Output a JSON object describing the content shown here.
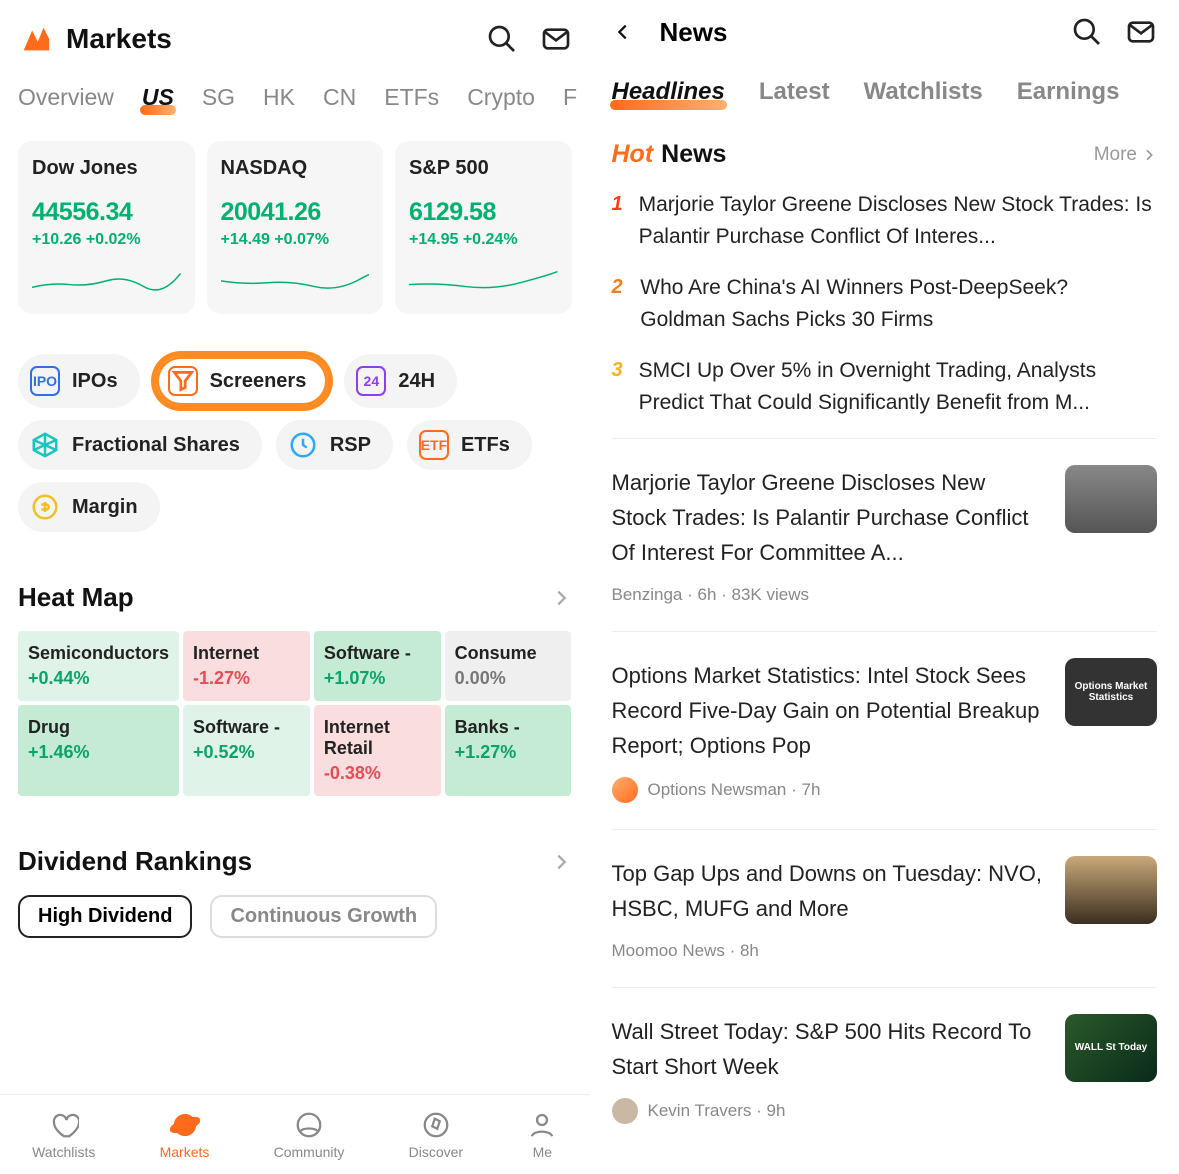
{
  "left": {
    "brand_title": "Markets",
    "tabs": [
      "Overview",
      "US",
      "SG",
      "HK",
      "CN",
      "ETFs",
      "Crypto",
      "F"
    ],
    "active_tab": "US",
    "indices": [
      {
        "name": "Dow Jones",
        "value": "44556.34",
        "change": "+10.26 +0.02%"
      },
      {
        "name": "NASDAQ",
        "value": "20041.26",
        "change": "+14.49 +0.07%"
      },
      {
        "name": "S&P 500",
        "value": "6129.58",
        "change": "+14.95 +0.24%"
      }
    ],
    "chips": [
      {
        "label": "IPOs",
        "icon": "ipo",
        "color": "#2f6fe8"
      },
      {
        "label": "Screeners",
        "icon": "funnel",
        "color": "#ff6b1a",
        "highlight": true
      },
      {
        "label": "24H",
        "icon": "24",
        "color": "#8a3ff0"
      },
      {
        "label": "Fractional Shares",
        "icon": "frac",
        "color": "#18c6c0"
      },
      {
        "label": "RSP",
        "icon": "clock",
        "color": "#2aa8ff"
      },
      {
        "label": "ETFs",
        "icon": "etf",
        "color": "#ff6b1a"
      },
      {
        "label": "Margin",
        "icon": "margin",
        "color": "#f0c020"
      }
    ],
    "heatmap_title": "Heat Map",
    "heatmap": [
      {
        "name": "Semiconductors",
        "pct": "+0.44%",
        "cls": "g"
      },
      {
        "name": "Internet",
        "pct": "-1.27%",
        "cls": "r"
      },
      {
        "name": "Software -",
        "pct": "+1.07%",
        "cls": "gs"
      },
      {
        "name": "Consume",
        "pct": "0.00%",
        "cls": "n"
      },
      {
        "name": "Drug",
        "pct": "+1.46%",
        "cls": "gs"
      },
      {
        "name": "Software -",
        "pct": "+0.52%",
        "cls": "g"
      },
      {
        "name": "Internet Retail",
        "pct": "-0.38%",
        "cls": "r"
      },
      {
        "name": "Banks -",
        "pct": "+1.27%",
        "cls": "gs"
      }
    ],
    "dividend_title": "Dividend Rankings",
    "dividend_pills": [
      "High Dividend",
      "Continuous Growth"
    ],
    "nav": [
      "Watchlists",
      "Markets",
      "Community",
      "Discover",
      "Me"
    ],
    "nav_active": "Markets"
  },
  "right": {
    "title": "News",
    "tabs": [
      "Headlines",
      "Latest",
      "Watchlists",
      "Earnings"
    ],
    "active_tab": "Headlines",
    "hot_prefix": "Hot",
    "hot_label": "News",
    "more_label": "More",
    "hot_items": [
      "Marjorie Taylor Greene Discloses New Stock Trades: Is Palantir Purchase Conflict Of Interes...",
      "Who Are China's AI Winners Post-DeepSeek? Goldman Sachs Picks 30 Firms",
      "SMCI Up Over 5% in Overnight Trading, Analysts Predict That Could Significantly Benefit from M..."
    ],
    "articles": [
      {
        "title": "Marjorie Taylor Greene Discloses New Stock Trades: Is Palantir Purchase Conflict Of Interest For Committee A...",
        "meta": "Benzinga · 6h · 83K views",
        "thumb": "grey",
        "avatar": false
      },
      {
        "title": "Options Market Statistics: Intel Stock Sees Record Five-Day Gain on Potential Breakup Report; Options Pop",
        "meta": "Options Newsman · 7h",
        "thumb_text": "Options Market Statistics",
        "avatar": true
      },
      {
        "title": "Top Gap Ups and Downs on Tuesday: NVO, HSBC, MUFG and More",
        "meta": "Moomoo News · 8h",
        "thumb": "city",
        "avatar": false
      },
      {
        "title": "Wall Street Today: S&P 500 Hits Record To Start Short Week",
        "meta": "Kevin Travers · 9h",
        "thumb": "wall",
        "thumb_text": "WALL St Today",
        "avatar": true,
        "avatar_cls": "photo"
      }
    ]
  }
}
